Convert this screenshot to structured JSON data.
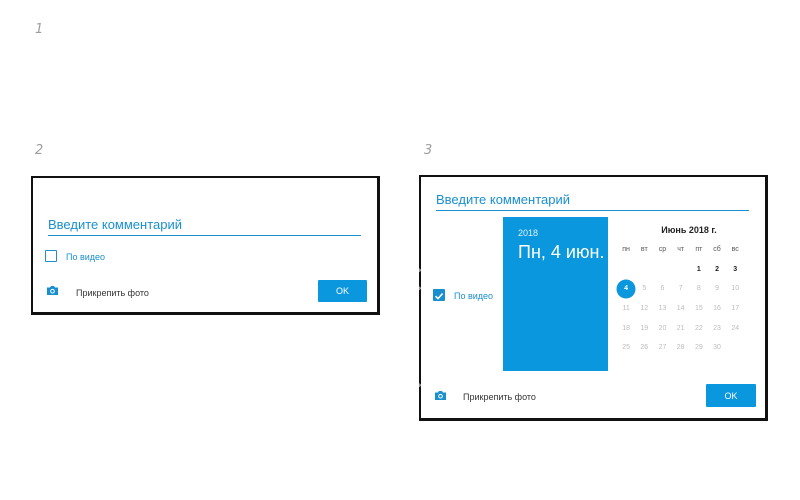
{
  "steps": [
    "1",
    "2",
    "3"
  ],
  "panel2": {
    "comment_placeholder": "Введите комментарий",
    "video_label": "По видео",
    "video_checked": false,
    "photo_label": "Прикрепить фото",
    "ok_label": "OK",
    "camera_icon": "camera-icon"
  },
  "panel3": {
    "comment_placeholder": "Введите комментарий",
    "video_label": "По видео",
    "video_checked": true,
    "photo_label": "Прикрепить фото",
    "ok_label": "OK",
    "camera_icon": "camera-icon",
    "date_header": {
      "year": "2018",
      "date": "Пн, 4 июн."
    },
    "calendar": {
      "month_title": "Июнь 2018 г.",
      "weekdays": [
        "пн",
        "вт",
        "ср",
        "чт",
        "пт",
        "сб",
        "вс"
      ],
      "leading_blanks": 4,
      "days": [
        "1",
        "2",
        "3",
        "4",
        "5",
        "6",
        "7",
        "8",
        "9",
        "10",
        "11",
        "12",
        "13",
        "14",
        "15",
        "16",
        "17",
        "18",
        "19",
        "20",
        "21",
        "22",
        "23",
        "24",
        "25",
        "26",
        "27",
        "28",
        "29",
        "30"
      ],
      "selected_day": "4",
      "enabled_days": [
        "1",
        "2",
        "3",
        "4"
      ]
    }
  },
  "colors": {
    "accent": "#0a97de",
    "accent_text": "#1a8fd0",
    "dialog_border": "#111111",
    "disabled_day": "#bdbdbd"
  }
}
